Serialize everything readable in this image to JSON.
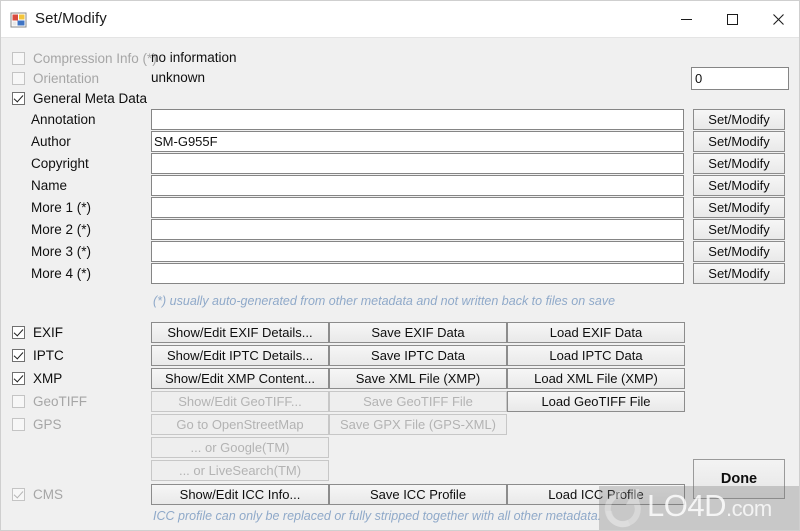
{
  "window": {
    "title": "Set/Modify",
    "icon": "app-window-icon",
    "minimize_label": "Minimize",
    "maximize_label": "Maximize",
    "close_label": "Close"
  },
  "top_checks": [
    {
      "name": "compression-info",
      "label": "Compression Info (*)",
      "checked": false,
      "enabled": false,
      "value": "no information"
    },
    {
      "name": "orientation",
      "label": "Orientation",
      "checked": false,
      "enabled": false,
      "value": "unknown"
    },
    {
      "name": "general-meta-data",
      "label": "General Meta Data",
      "checked": true,
      "enabled": true,
      "value": ""
    }
  ],
  "orientation_spinner": {
    "value": "0",
    "up_label": "increase",
    "down_label": "decrease"
  },
  "meta_fields": [
    {
      "label": "Annotation",
      "value": "",
      "placeholder": "",
      "button": "Set/Modify"
    },
    {
      "label": "Author",
      "value": "SM-G955F",
      "placeholder": "",
      "button": "Set/Modify"
    },
    {
      "label": "Copyright",
      "value": "",
      "placeholder": "",
      "button": "Set/Modify"
    },
    {
      "label": "Name",
      "value": "",
      "placeholder": "",
      "button": "Set/Modify"
    },
    {
      "label": "More 1 (*)",
      "value": "",
      "placeholder": "",
      "button": "Set/Modify"
    },
    {
      "label": "More 2 (*)",
      "value": "",
      "placeholder": "",
      "button": "Set/Modify"
    },
    {
      "label": "More 3 (*)",
      "value": "",
      "placeholder": "",
      "button": "Set/Modify"
    },
    {
      "label": "More 4 (*)",
      "value": "",
      "placeholder": "",
      "button": "Set/Modify"
    }
  ],
  "hints": {
    "auto_generated": "(*) usually auto-generated from other metadata and not written back to files on save",
    "icc_profile": "ICC profile can only be replaced or fully stripped together with all other metadata."
  },
  "format_rows": [
    {
      "name": "exif",
      "label": "EXIF",
      "checked": true,
      "enabled": true,
      "buttons": [
        {
          "label": "Show/Edit EXIF Details...",
          "enabled": true
        },
        {
          "label": "Save EXIF Data",
          "enabled": true
        },
        {
          "label": "Load EXIF Data",
          "enabled": true
        }
      ]
    },
    {
      "name": "iptc",
      "label": "IPTC",
      "checked": true,
      "enabled": true,
      "buttons": [
        {
          "label": "Show/Edit IPTC Details...",
          "enabled": true
        },
        {
          "label": "Save IPTC Data",
          "enabled": true
        },
        {
          "label": "Load IPTC Data",
          "enabled": true
        }
      ]
    },
    {
      "name": "xmp",
      "label": "XMP",
      "checked": true,
      "enabled": true,
      "buttons": [
        {
          "label": "Show/Edit XMP Content...",
          "enabled": true
        },
        {
          "label": "Save XML File (XMP)",
          "enabled": true
        },
        {
          "label": "Load XML File (XMP)",
          "enabled": true
        }
      ]
    },
    {
      "name": "geotiff",
      "label": "GeoTIFF",
      "checked": false,
      "enabled": false,
      "buttons": [
        {
          "label": "Show/Edit GeoTIFF...",
          "enabled": false
        },
        {
          "label": "Save GeoTIFF File",
          "enabled": false
        },
        {
          "label": "Load GeoTIFF File",
          "enabled": true
        }
      ]
    },
    {
      "name": "gps",
      "label": "GPS",
      "checked": false,
      "enabled": false,
      "buttons": [
        {
          "label": "Go to OpenStreetMap",
          "enabled": false
        },
        {
          "label": "Save GPX File (GPS-XML)",
          "enabled": false
        },
        {
          "label": "",
          "enabled": false
        }
      ]
    },
    {
      "name": "google",
      "label": "",
      "checked": null,
      "enabled": false,
      "buttons": [
        {
          "label": "... or Google(TM)",
          "enabled": false
        },
        {
          "label": "",
          "enabled": false
        },
        {
          "label": "",
          "enabled": false
        }
      ]
    },
    {
      "name": "livesearch",
      "label": "",
      "checked": null,
      "enabled": false,
      "buttons": [
        {
          "label": "... or LiveSearch(TM)",
          "enabled": false
        },
        {
          "label": "",
          "enabled": false
        },
        {
          "label": "",
          "enabled": false
        }
      ]
    },
    {
      "name": "cms",
      "label": "CMS",
      "checked": true,
      "enabled": false,
      "buttons": [
        {
          "label": "Show/Edit ICC Info...",
          "enabled": true
        },
        {
          "label": "Save ICC Profile",
          "enabled": true
        },
        {
          "label": "Load ICC Profile",
          "enabled": true
        }
      ]
    }
  ],
  "done_button": {
    "label": "Done"
  },
  "watermark": {
    "text": "LO4D",
    "domain": ".com"
  },
  "colors": {
    "window_bg": "#f0f0f0",
    "titlebar_bg": "#ffffff",
    "hint_text": "#8fa9c9",
    "disabled_text": "#a6a6a6",
    "text": "#101010",
    "input_border": "#858585",
    "button_border": "#8c8c8c"
  }
}
